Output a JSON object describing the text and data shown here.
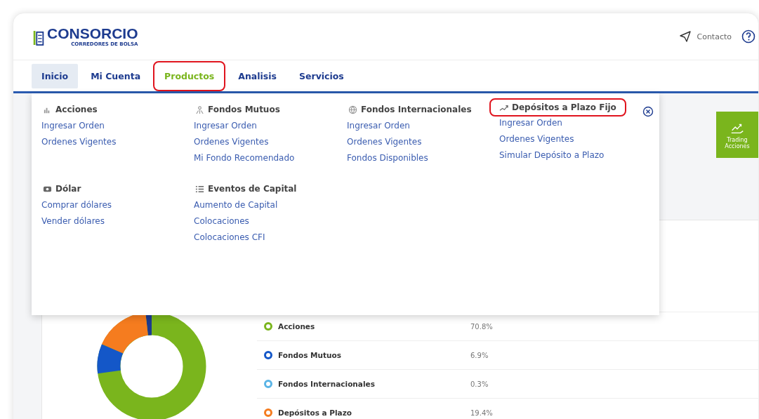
{
  "logo": {
    "name": "CONSORCIO",
    "tagline": "CORREDORES DE BOLSA"
  },
  "header": {
    "contact": "Contacto"
  },
  "tabs": [
    {
      "label": "Inicio",
      "selected": true,
      "highlighted": false
    },
    {
      "label": "Mi Cuenta",
      "selected": false,
      "highlighted": false
    },
    {
      "label": "Productos",
      "selected": false,
      "highlighted": true
    },
    {
      "label": "Analisis",
      "selected": false,
      "highlighted": false
    },
    {
      "label": "Servicios",
      "selected": false,
      "highlighted": false
    }
  ],
  "menu": {
    "groups": [
      {
        "kind": "acciones",
        "title": "Acciones",
        "highlighted": false,
        "links": [
          "Ingresar Orden",
          "Ordenes Vigentes"
        ]
      },
      {
        "kind": "fondos",
        "title": "Fondos Mutuos",
        "highlighted": false,
        "links": [
          "Ingresar Orden",
          "Ordenes Vigentes",
          "Mi Fondo Recomendado"
        ]
      },
      {
        "kind": "globe",
        "title": "Fondos Internacionales",
        "highlighted": false,
        "links": [
          "Ingresar Orden",
          "Ordenes Vigentes",
          "Fondos Disponibles"
        ]
      },
      {
        "kind": "trend",
        "title": "Depósitos a Plazo Fijo",
        "highlighted": true,
        "links": [
          "Ingresar Orden",
          "Ordenes Vigentes",
          "Simular Depósito a Plazo"
        ]
      },
      {
        "kind": "dollar",
        "title": "Dólar",
        "highlighted": false,
        "links": [
          "Comprar dólares",
          "Vender dólares"
        ]
      },
      {
        "kind": "list",
        "title": "Eventos de Capital",
        "highlighted": false,
        "links": [
          "Aumento de Capital",
          "Colocaciones",
          "Colocaciones CFI"
        ]
      }
    ]
  },
  "trading_tile": {
    "label": "Trading Acciones"
  },
  "legend": [
    {
      "label": "Acciones",
      "value": "70.8%",
      "color": "#7ab51d"
    },
    {
      "label": "Fondos Mutuos",
      "value": "6.9%",
      "color": "#1457c8"
    },
    {
      "label": "Fondos Internacionales",
      "value": "0.3%",
      "color": "#5ab4e6"
    },
    {
      "label": "Depósitos a Plazo",
      "value": "19.4%",
      "color": "#f57c1f"
    }
  ]
}
